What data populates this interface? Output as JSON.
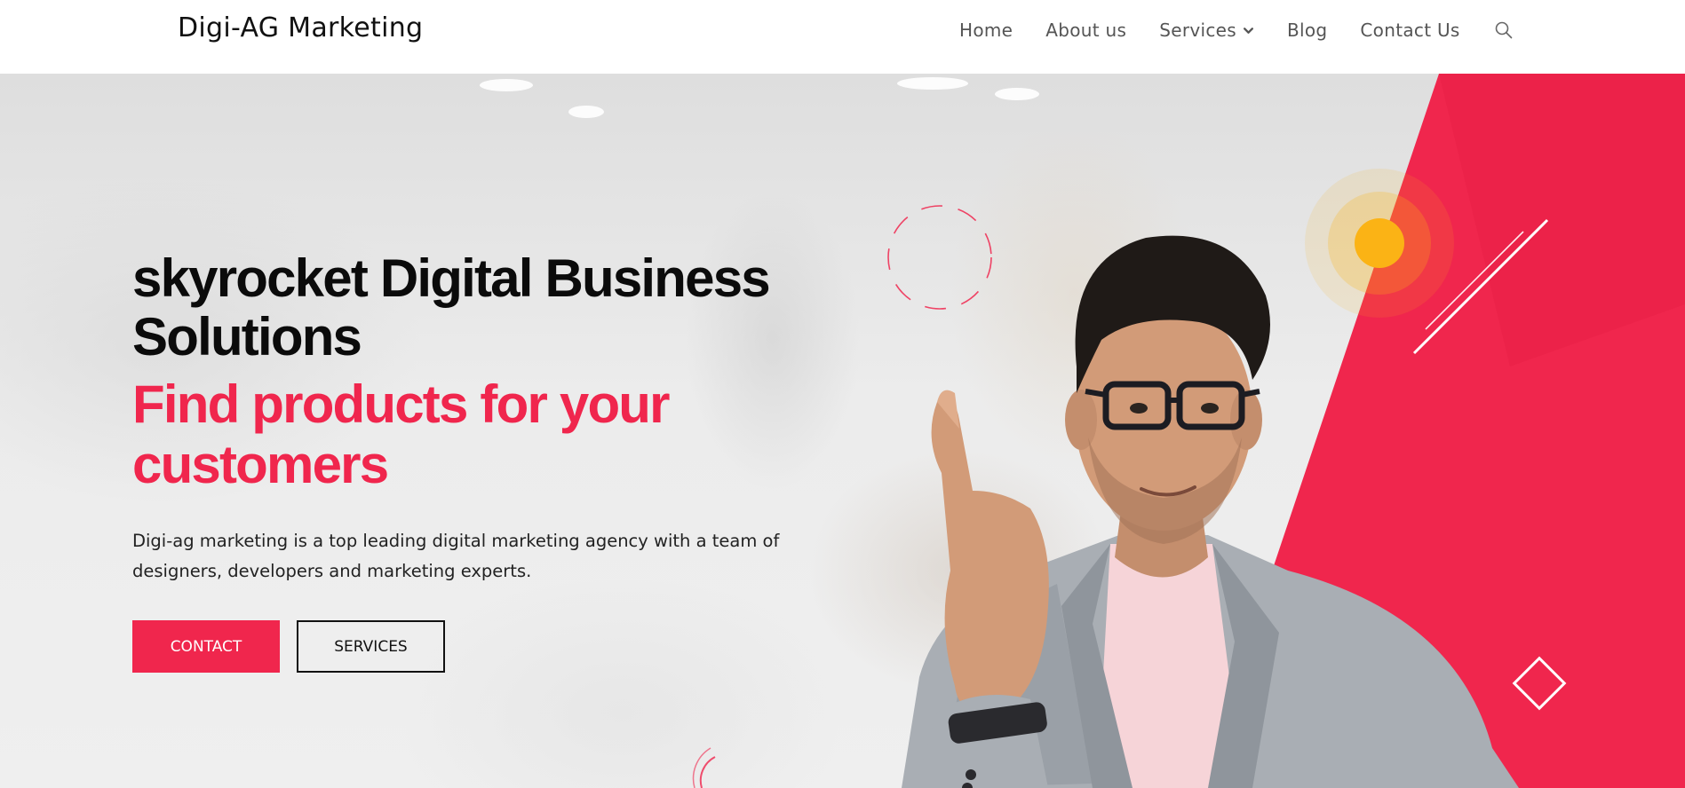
{
  "header": {
    "logo": "Digi-AG Marketing",
    "nav": [
      {
        "label": "Home"
      },
      {
        "label": "About us"
      },
      {
        "label": "Services",
        "has_dropdown": true
      },
      {
        "label": "Blog"
      },
      {
        "label": "Contact Us"
      }
    ],
    "search_icon": "search-icon"
  },
  "hero": {
    "headline": "skyrocket Digital Business Solutions",
    "subheadline": "Find products for your customers",
    "description": "Digi-ag marketing is a top leading digital marketing agency with a team of designers, developers and marketing experts.",
    "buttons": {
      "contact": "CONTACT",
      "services": "SERVICES"
    }
  },
  "colors": {
    "accent": "#f0264d",
    "text": "#0b0b0b",
    "nav_text": "#555555",
    "yellow_dot": "#fbb315"
  }
}
